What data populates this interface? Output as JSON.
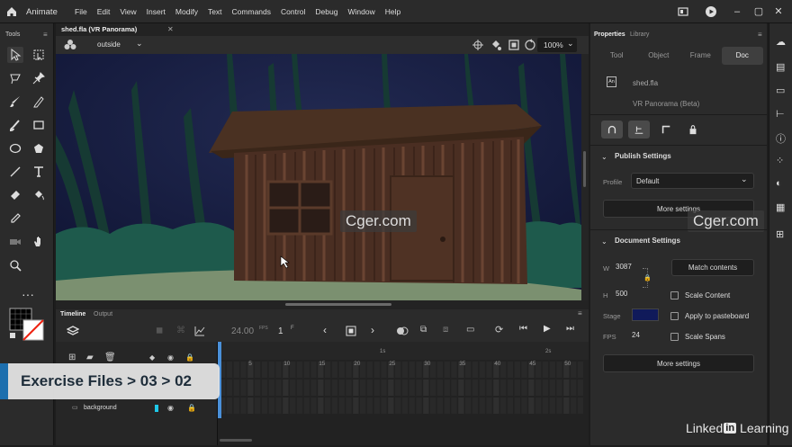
{
  "app": {
    "name": "Animate"
  },
  "menu": [
    "File",
    "Edit",
    "View",
    "Insert",
    "Modify",
    "Text",
    "Commands",
    "Control",
    "Debug",
    "Window",
    "Help"
  ],
  "tools_panel": {
    "title": "Tools"
  },
  "document": {
    "tab_title": "shed.fla (VR Panorama)",
    "scene": "outside",
    "zoom": "100%"
  },
  "timeline": {
    "tab_timeline": "Timeline",
    "tab_output": "Output",
    "fps": "24.00",
    "fps_unit": "FPS",
    "frame": "1",
    "frame_unit": "F",
    "ruler_secs": [
      "1s",
      "2s"
    ],
    "ruler_frames": [
      "5",
      "10",
      "15",
      "20",
      "25",
      "30",
      "35",
      "40",
      "45",
      "50"
    ],
    "layer_name": "background"
  },
  "properties": {
    "tab_properties": "Properties",
    "tab_library": "Library",
    "subtabs": [
      "Tool",
      "Object",
      "Frame",
      "Doc"
    ],
    "doc_icon": "An",
    "file_name": "shed.fla",
    "doc_type": "VR Panorama (Beta)",
    "publish_heading": "Publish Settings",
    "profile_label": "Profile",
    "profile_value": "Default",
    "more_settings_1": "More settings",
    "document_heading": "Document Settings",
    "w_label": "W",
    "w_value": "3087",
    "h_label": "H",
    "h_value": "500",
    "match_contents": "Match contents",
    "scale_content": "Scale Content",
    "stage_label": "Stage",
    "stage_color": "#101a5a",
    "apply_pasteboard": "Apply to pasteboard",
    "fps_label": "FPS",
    "fps_value": "24",
    "scale_spans": "Scale Spans",
    "more_settings_2": "More settings"
  },
  "overlay": {
    "watermark": "Cger.com",
    "exercise_path": "Exercise Files > 03 > 02",
    "brand_linked": "Linked",
    "brand_in": "in",
    "brand_learning": "Learning"
  }
}
